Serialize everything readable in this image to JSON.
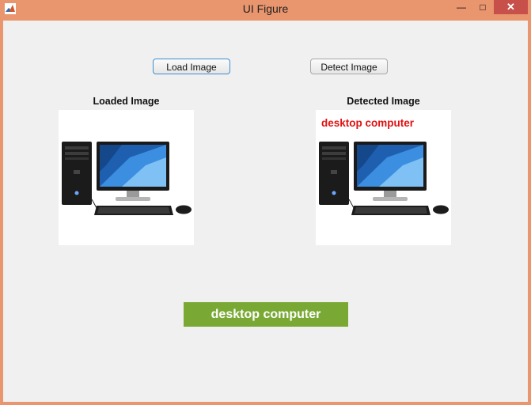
{
  "window": {
    "title": "UI Figure",
    "icon": "matlab-app-icon",
    "minimize": "minimize-icon",
    "maximize": "maximize-icon",
    "close": "close-icon"
  },
  "buttons": {
    "load_label": "Load Image",
    "detect_label": "Detect Image"
  },
  "panels": {
    "loaded_title": "Loaded Image",
    "detected_title": "Detected Image",
    "detected_overlay": "desktop computer"
  },
  "result": {
    "label": "desktop computer",
    "bg_color": "#79a934"
  },
  "colors": {
    "titlebar": "#e9956e",
    "close_button": "#c7504b",
    "overlay_text": "#e01010"
  }
}
